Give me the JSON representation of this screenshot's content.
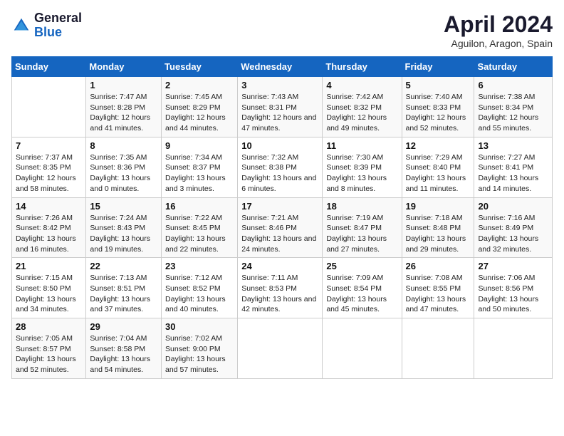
{
  "header": {
    "logo_line1": "General",
    "logo_line2": "Blue",
    "title": "April 2024",
    "subtitle": "Aguilon, Aragon, Spain"
  },
  "days_of_week": [
    "Sunday",
    "Monday",
    "Tuesday",
    "Wednesday",
    "Thursday",
    "Friday",
    "Saturday"
  ],
  "weeks": [
    [
      {
        "day": null
      },
      {
        "day": "1",
        "sunrise": "Sunrise: 7:47 AM",
        "sunset": "Sunset: 8:28 PM",
        "daylight": "Daylight: 12 hours and 41 minutes."
      },
      {
        "day": "2",
        "sunrise": "Sunrise: 7:45 AM",
        "sunset": "Sunset: 8:29 PM",
        "daylight": "Daylight: 12 hours and 44 minutes."
      },
      {
        "day": "3",
        "sunrise": "Sunrise: 7:43 AM",
        "sunset": "Sunset: 8:31 PM",
        "daylight": "Daylight: 12 hours and 47 minutes."
      },
      {
        "day": "4",
        "sunrise": "Sunrise: 7:42 AM",
        "sunset": "Sunset: 8:32 PM",
        "daylight": "Daylight: 12 hours and 49 minutes."
      },
      {
        "day": "5",
        "sunrise": "Sunrise: 7:40 AM",
        "sunset": "Sunset: 8:33 PM",
        "daylight": "Daylight: 12 hours and 52 minutes."
      },
      {
        "day": "6",
        "sunrise": "Sunrise: 7:38 AM",
        "sunset": "Sunset: 8:34 PM",
        "daylight": "Daylight: 12 hours and 55 minutes."
      }
    ],
    [
      {
        "day": "7",
        "sunrise": "Sunrise: 7:37 AM",
        "sunset": "Sunset: 8:35 PM",
        "daylight": "Daylight: 12 hours and 58 minutes."
      },
      {
        "day": "8",
        "sunrise": "Sunrise: 7:35 AM",
        "sunset": "Sunset: 8:36 PM",
        "daylight": "Daylight: 13 hours and 0 minutes."
      },
      {
        "day": "9",
        "sunrise": "Sunrise: 7:34 AM",
        "sunset": "Sunset: 8:37 PM",
        "daylight": "Daylight: 13 hours and 3 minutes."
      },
      {
        "day": "10",
        "sunrise": "Sunrise: 7:32 AM",
        "sunset": "Sunset: 8:38 PM",
        "daylight": "Daylight: 13 hours and 6 minutes."
      },
      {
        "day": "11",
        "sunrise": "Sunrise: 7:30 AM",
        "sunset": "Sunset: 8:39 PM",
        "daylight": "Daylight: 13 hours and 8 minutes."
      },
      {
        "day": "12",
        "sunrise": "Sunrise: 7:29 AM",
        "sunset": "Sunset: 8:40 PM",
        "daylight": "Daylight: 13 hours and 11 minutes."
      },
      {
        "day": "13",
        "sunrise": "Sunrise: 7:27 AM",
        "sunset": "Sunset: 8:41 PM",
        "daylight": "Daylight: 13 hours and 14 minutes."
      }
    ],
    [
      {
        "day": "14",
        "sunrise": "Sunrise: 7:26 AM",
        "sunset": "Sunset: 8:42 PM",
        "daylight": "Daylight: 13 hours and 16 minutes."
      },
      {
        "day": "15",
        "sunrise": "Sunrise: 7:24 AM",
        "sunset": "Sunset: 8:43 PM",
        "daylight": "Daylight: 13 hours and 19 minutes."
      },
      {
        "day": "16",
        "sunrise": "Sunrise: 7:22 AM",
        "sunset": "Sunset: 8:45 PM",
        "daylight": "Daylight: 13 hours and 22 minutes."
      },
      {
        "day": "17",
        "sunrise": "Sunrise: 7:21 AM",
        "sunset": "Sunset: 8:46 PM",
        "daylight": "Daylight: 13 hours and 24 minutes."
      },
      {
        "day": "18",
        "sunrise": "Sunrise: 7:19 AM",
        "sunset": "Sunset: 8:47 PM",
        "daylight": "Daylight: 13 hours and 27 minutes."
      },
      {
        "day": "19",
        "sunrise": "Sunrise: 7:18 AM",
        "sunset": "Sunset: 8:48 PM",
        "daylight": "Daylight: 13 hours and 29 minutes."
      },
      {
        "day": "20",
        "sunrise": "Sunrise: 7:16 AM",
        "sunset": "Sunset: 8:49 PM",
        "daylight": "Daylight: 13 hours and 32 minutes."
      }
    ],
    [
      {
        "day": "21",
        "sunrise": "Sunrise: 7:15 AM",
        "sunset": "Sunset: 8:50 PM",
        "daylight": "Daylight: 13 hours and 34 minutes."
      },
      {
        "day": "22",
        "sunrise": "Sunrise: 7:13 AM",
        "sunset": "Sunset: 8:51 PM",
        "daylight": "Daylight: 13 hours and 37 minutes."
      },
      {
        "day": "23",
        "sunrise": "Sunrise: 7:12 AM",
        "sunset": "Sunset: 8:52 PM",
        "daylight": "Daylight: 13 hours and 40 minutes."
      },
      {
        "day": "24",
        "sunrise": "Sunrise: 7:11 AM",
        "sunset": "Sunset: 8:53 PM",
        "daylight": "Daylight: 13 hours and 42 minutes."
      },
      {
        "day": "25",
        "sunrise": "Sunrise: 7:09 AM",
        "sunset": "Sunset: 8:54 PM",
        "daylight": "Daylight: 13 hours and 45 minutes."
      },
      {
        "day": "26",
        "sunrise": "Sunrise: 7:08 AM",
        "sunset": "Sunset: 8:55 PM",
        "daylight": "Daylight: 13 hours and 47 minutes."
      },
      {
        "day": "27",
        "sunrise": "Sunrise: 7:06 AM",
        "sunset": "Sunset: 8:56 PM",
        "daylight": "Daylight: 13 hours and 50 minutes."
      }
    ],
    [
      {
        "day": "28",
        "sunrise": "Sunrise: 7:05 AM",
        "sunset": "Sunset: 8:57 PM",
        "daylight": "Daylight: 13 hours and 52 minutes."
      },
      {
        "day": "29",
        "sunrise": "Sunrise: 7:04 AM",
        "sunset": "Sunset: 8:58 PM",
        "daylight": "Daylight: 13 hours and 54 minutes."
      },
      {
        "day": "30",
        "sunrise": "Sunrise: 7:02 AM",
        "sunset": "Sunset: 9:00 PM",
        "daylight": "Daylight: 13 hours and 57 minutes."
      },
      {
        "day": null
      },
      {
        "day": null
      },
      {
        "day": null
      },
      {
        "day": null
      }
    ]
  ]
}
